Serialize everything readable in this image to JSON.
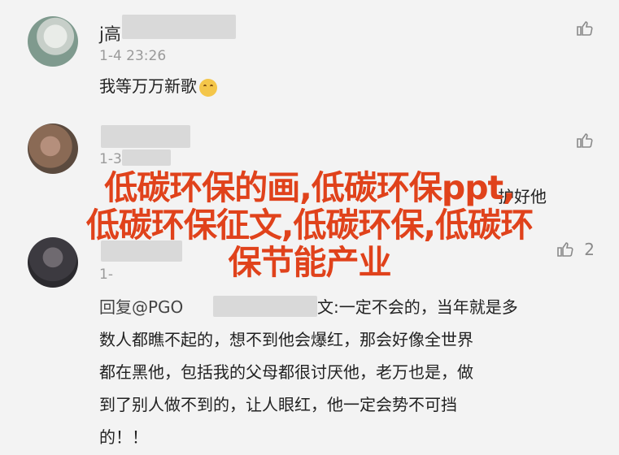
{
  "comments": [
    {
      "name": "j高",
      "time": "1-4 23:26",
      "text": "我等万万新歌",
      "emoji": "smile-emoji"
    },
    {
      "name": "",
      "time": "1-3",
      "text": "",
      "partial_text": "护好他"
    },
    {
      "name": "",
      "time": "1-",
      "like_count": "2",
      "reply_prefix": "回复@PGO",
      "text_lines": [
        "文:一定不会的，当年就是多",
        "数人都瞧不起的，想不到他会爆红，那会好像全世界",
        "都在黑他，包括我的父母都很讨厌他，老万也是，做",
        "到了别人做不到的，让人眼红，他一定会势不可挡",
        "的！！"
      ]
    }
  ],
  "overlay": {
    "lines": [
      "低碳环保的画,低碳环保ppt,",
      "低碳环保征文,低碳环保,低碳环",
      "保节能产业"
    ],
    "color": "#e0421b"
  }
}
